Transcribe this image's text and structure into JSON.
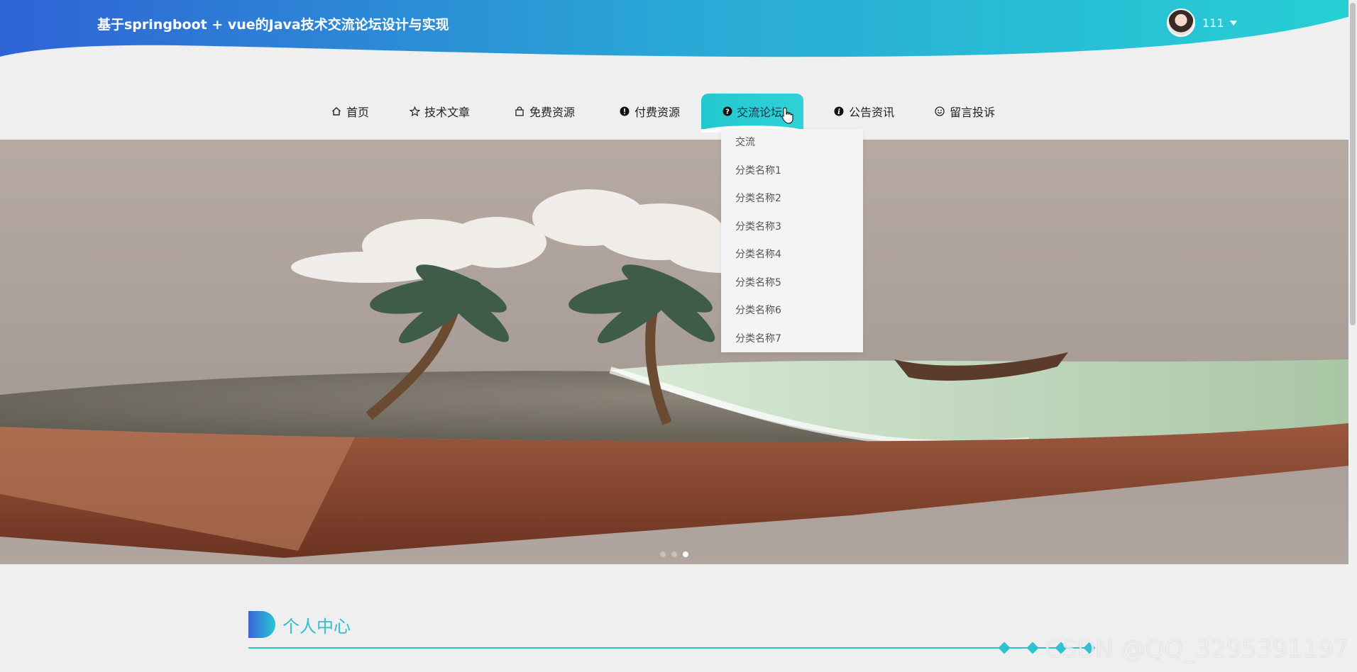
{
  "header": {
    "site_title": "基于springboot + vue的Java技术交流论坛设计与实现",
    "user_name": "111"
  },
  "nav": {
    "items": [
      {
        "label": "首页",
        "icon": "home-icon"
      },
      {
        "label": "技术文章",
        "icon": "star-icon"
      },
      {
        "label": "免费资源",
        "icon": "bag-icon"
      },
      {
        "label": "付费资源",
        "icon": "alert-circle-icon"
      },
      {
        "label": "交流论坛",
        "icon": "question-circle-icon",
        "active": true
      },
      {
        "label": "公告资讯",
        "icon": "info-circle-icon"
      },
      {
        "label": "留言投诉",
        "icon": "smile-icon"
      }
    ]
  },
  "dropdown": {
    "items": [
      "交流",
      "分类名称1",
      "分类名称2",
      "分类名称3",
      "分类名称4",
      "分类名称5",
      "分类名称6",
      "分类名称7"
    ]
  },
  "carousel": {
    "slide_count": 3,
    "active_index": 2
  },
  "section": {
    "title": "个人中心"
  },
  "watermark": "CSDN @QQ_3295391197",
  "colors": {
    "accent": "#2ec1cf",
    "header_start": "#3a64d8",
    "header_end": "#27c7d3"
  }
}
